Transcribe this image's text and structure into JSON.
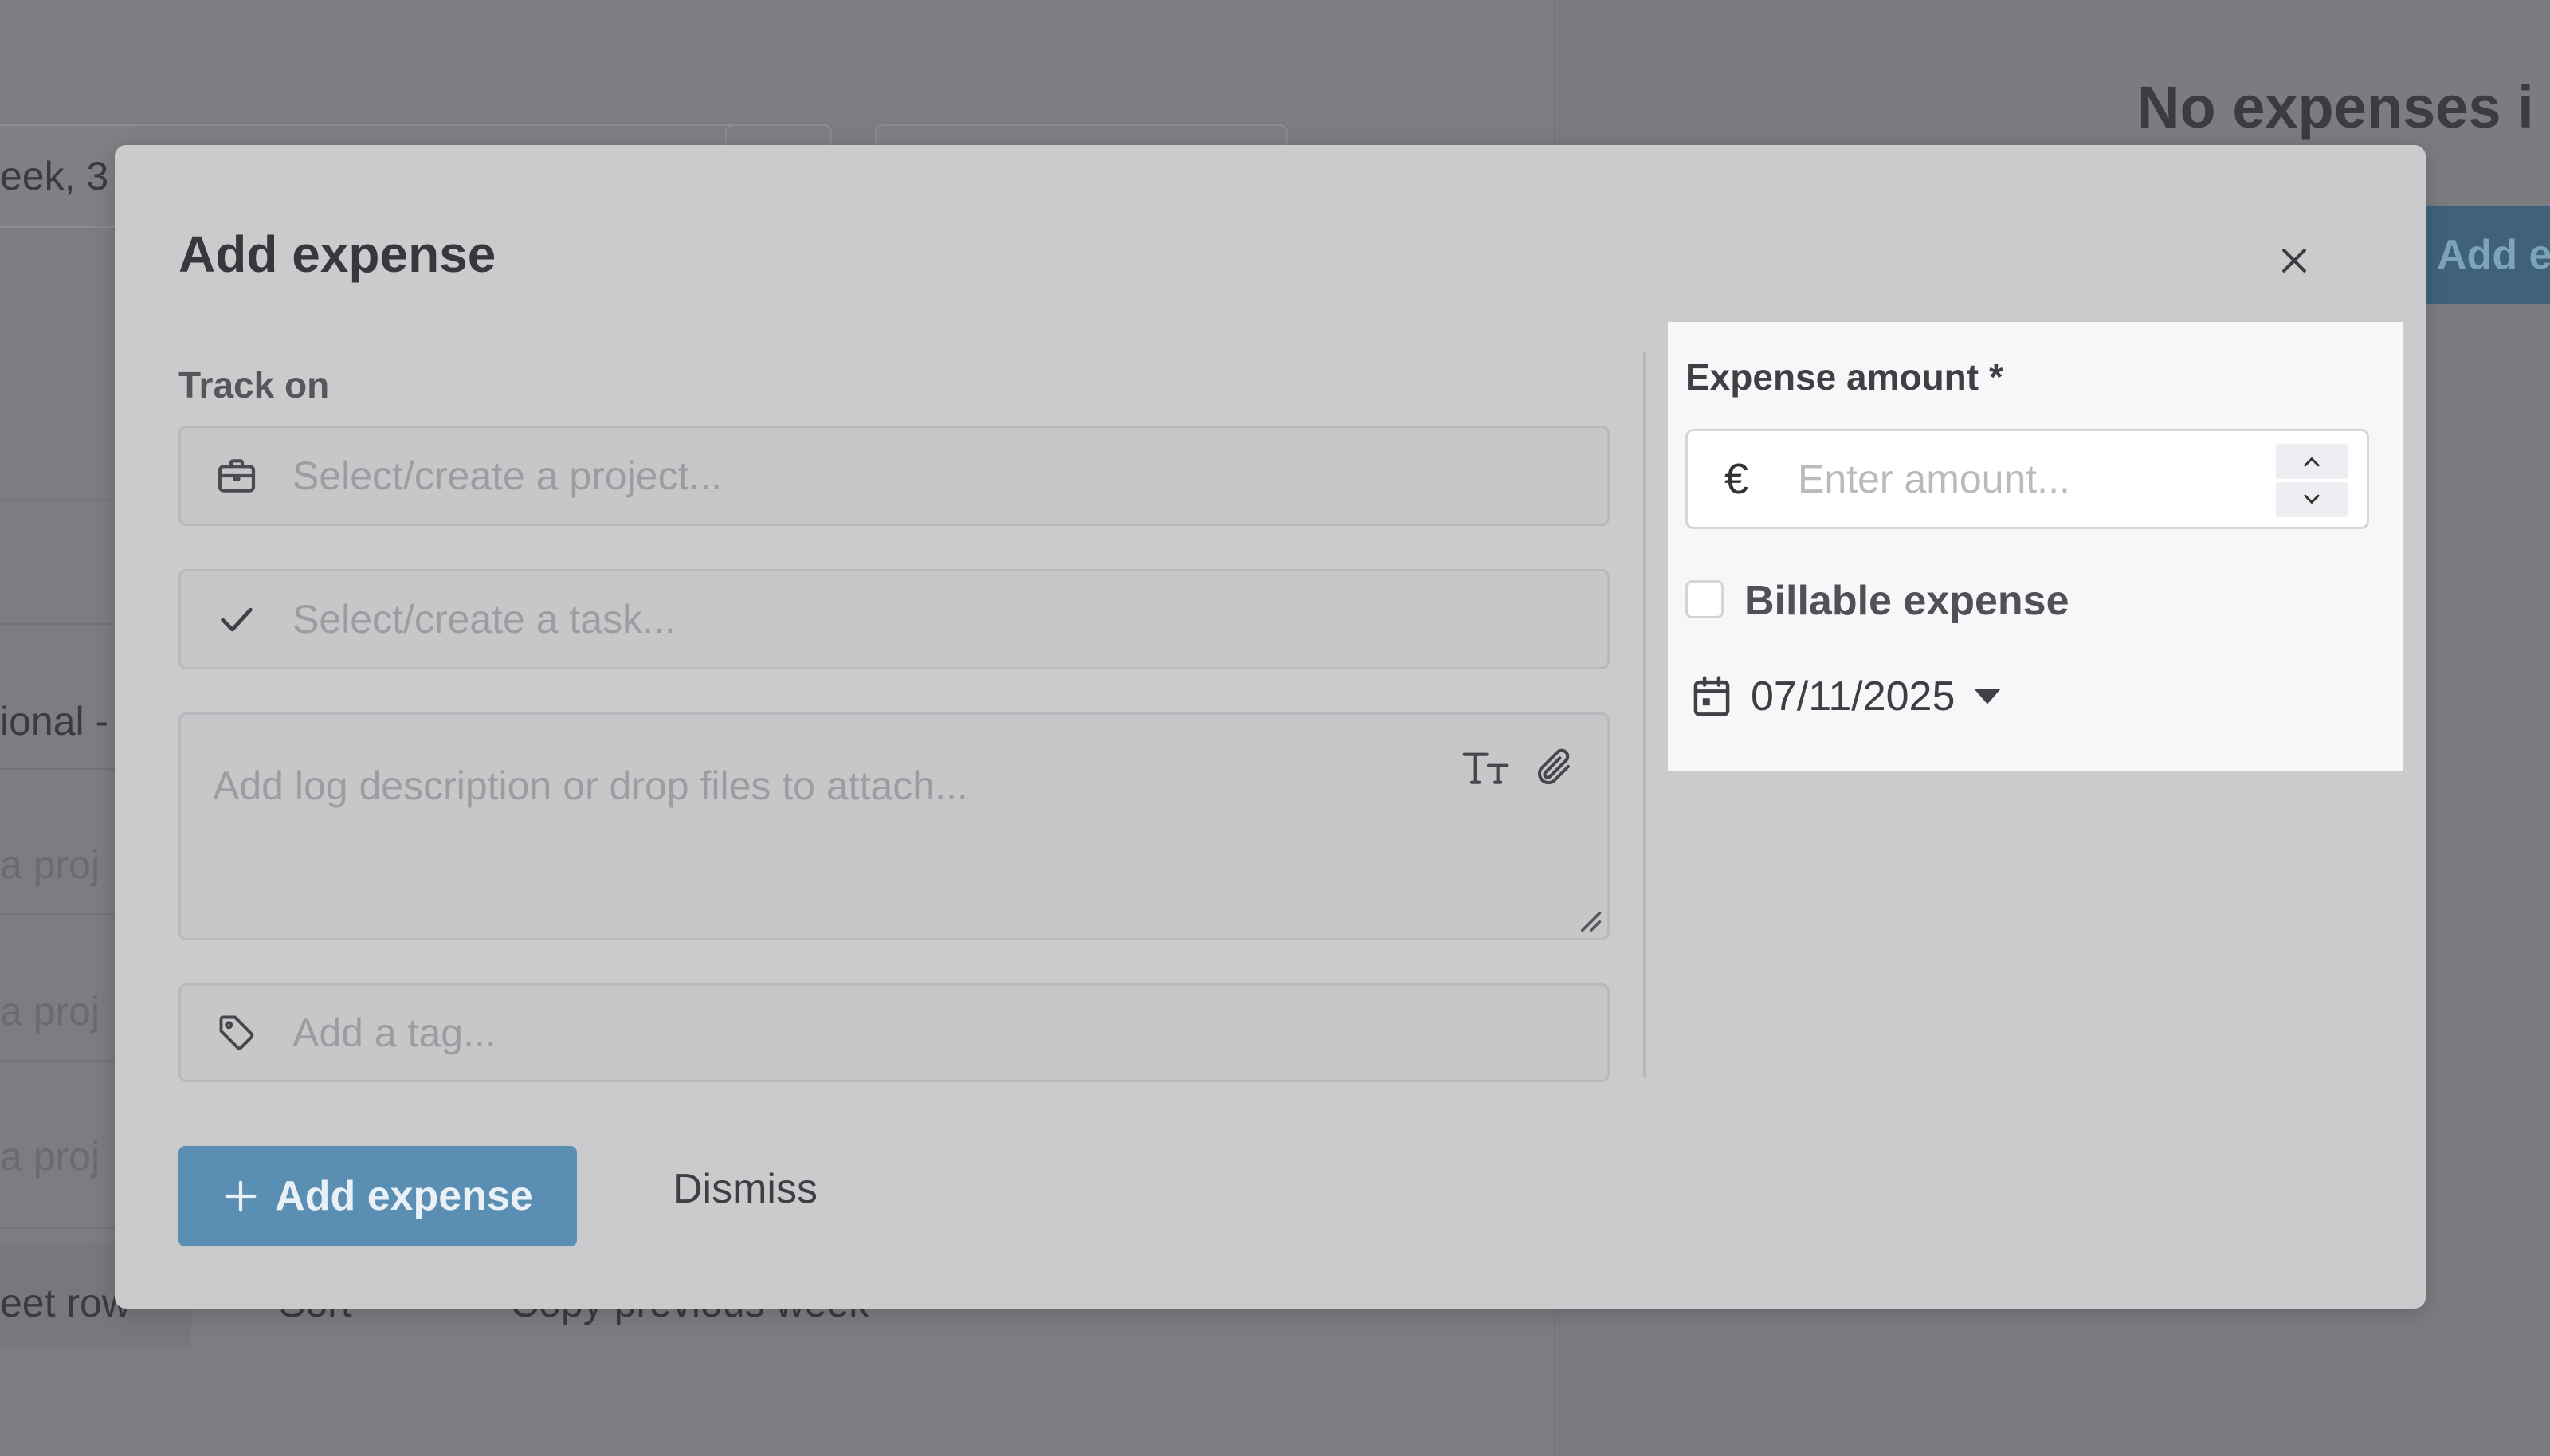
{
  "background": {
    "left_fragments": [
      "eek, 3",
      "ional -",
      "a proj",
      "a proj",
      "a proj",
      "eet row",
      "Sort",
      "Copy previous week"
    ],
    "right_title": "No expenses i",
    "right_button": "Add e"
  },
  "modal": {
    "title": "Add expense",
    "close_icon": "close-icon",
    "track_on_label": "Track on",
    "project_placeholder": "Select/create a project...",
    "task_placeholder": "Select/create a task...",
    "description_placeholder": "Add log description or drop files to attach...",
    "tag_placeholder": "Add a tag...",
    "amount_label": "Expense amount *",
    "currency_symbol": "€",
    "amount_placeholder": "Enter amount...",
    "billable_label": "Billable expense",
    "billable_checked": false,
    "date": "07/11/2025",
    "add_button_label": "Add expense",
    "dismiss_label": "Dismiss"
  },
  "colors": {
    "overlay": "#7c7d80",
    "modal_bg": "#cbcbcd",
    "panel_bg": "#f6f7f9",
    "primary": "#5a8fb3"
  }
}
